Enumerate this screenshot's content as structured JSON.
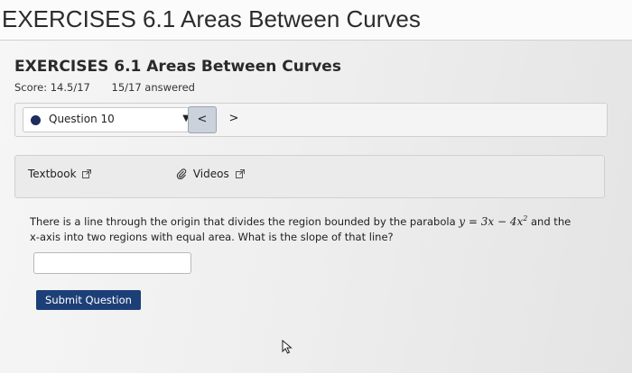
{
  "header": {
    "title": "EXERCISES 6.1 Areas Between Curves"
  },
  "assignment": {
    "title": "EXERCISES 6.1 Areas Between Curves",
    "score_label": "Score: 14.5/17",
    "answered_label": "15/17 answered"
  },
  "question_nav": {
    "selected": "Question 10",
    "prev": "<",
    "next": ">"
  },
  "resources": {
    "textbook": "Textbook",
    "videos": "Videos"
  },
  "question": {
    "text_before": "There is a line through the origin that divides the region bounded by the parabola ",
    "math_y": "y",
    "math_eq": " = ",
    "math_3x": "3x",
    "math_minus": " − ",
    "math_4x": "4x",
    "math_exp": "2",
    "text_after": " and the x-axis into two regions with equal area. What is the slope of that line?"
  },
  "answer": {
    "value": "",
    "placeholder": ""
  },
  "submit_label": "Submit Question",
  "colors": {
    "submit_button": "#1d3f78",
    "question_dot": "#1d2d5e",
    "prev_button": "#cbd2dc"
  },
  "icons": {
    "external_link": "external-link-icon",
    "paperclip": "paperclip-icon",
    "cursor": "mouse-pointer-icon"
  }
}
